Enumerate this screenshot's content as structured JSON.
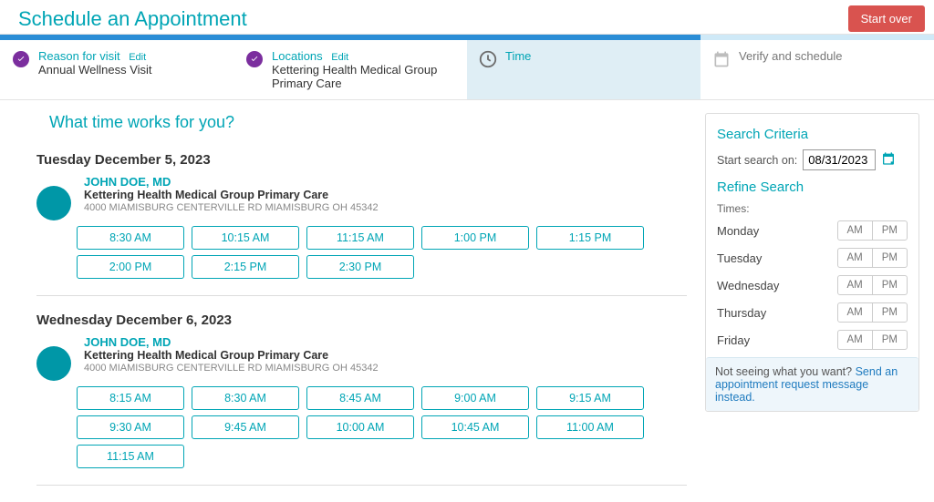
{
  "header": {
    "title": "Schedule an Appointment",
    "start_over": "Start over"
  },
  "steps": {
    "reason": {
      "label": "Reason for visit",
      "edit": "Edit",
      "value": "Annual Wellness Visit"
    },
    "locations": {
      "label": "Locations",
      "edit": "Edit",
      "value": "Kettering Health Medical Group Primary Care"
    },
    "time": {
      "label": "Time"
    },
    "verify": {
      "label": "Verify and schedule"
    }
  },
  "prompt": "What time works for you?",
  "days": [
    {
      "title": "Tuesday December 5, 2023",
      "provider": {
        "name": "JOHN DOE, MD",
        "location": "Kettering Health Medical Group Primary Care",
        "address": "4000 MIAMISBURG CENTERVILLE RD MIAMISBURG OH 45342"
      },
      "times": [
        "8:30 AM",
        "10:15 AM",
        "11:15 AM",
        "1:00 PM",
        "1:15 PM",
        "2:00 PM",
        "2:15 PM",
        "2:30 PM"
      ]
    },
    {
      "title": "Wednesday December 6, 2023",
      "provider": {
        "name": "JOHN DOE, MD",
        "location": "Kettering Health Medical Group Primary Care",
        "address": "4000 MIAMISBURG CENTERVILLE RD MIAMISBURG OH 45342"
      },
      "times": [
        "8:15 AM",
        "8:30 AM",
        "8:45 AM",
        "9:00 AM",
        "9:15 AM",
        "9:30 AM",
        "9:45 AM",
        "10:00 AM",
        "10:45 AM",
        "11:00 AM",
        "11:15 AM"
      ]
    }
  ],
  "search": {
    "criteria_title": "Search Criteria",
    "start_label": "Start search on:",
    "start_value": "08/31/2023",
    "refine_title": "Refine Search",
    "times_label": "Times:",
    "am": "AM",
    "pm": "PM",
    "weekdays": [
      "Monday",
      "Tuesday",
      "Wednesday",
      "Thursday",
      "Friday"
    ]
  },
  "infobox": {
    "lead": "Not seeing what you want?",
    "link": "Send an appointment request message instead."
  }
}
